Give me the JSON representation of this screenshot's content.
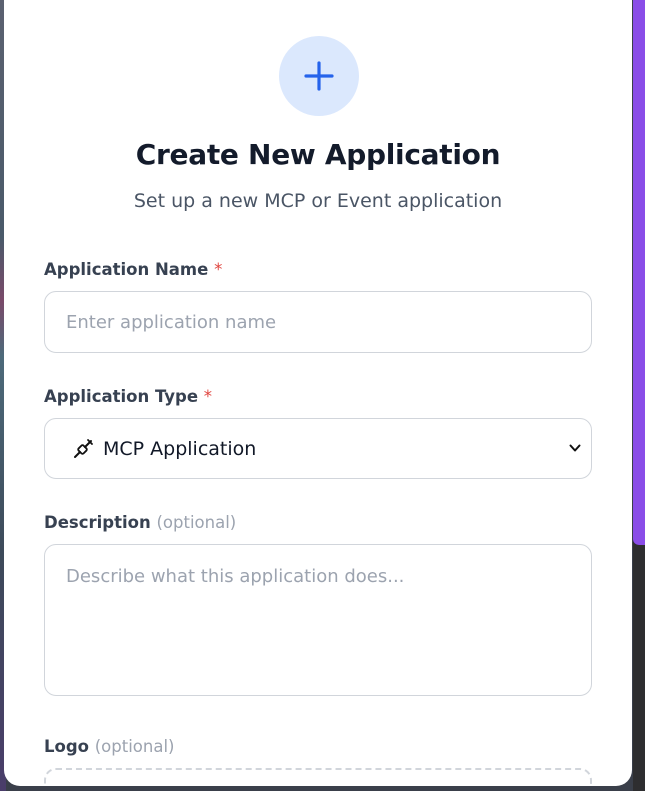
{
  "modal": {
    "title": "Create New Application",
    "subtitle": "Set up a new MCP or Event application",
    "header_icon": "plus-icon"
  },
  "form": {
    "name": {
      "label": "Application Name",
      "required_mark": "*",
      "placeholder": "Enter application name",
      "value": ""
    },
    "type": {
      "label": "Application Type",
      "required_mark": "*",
      "selected": "MCP Application",
      "icon": "plug-icon"
    },
    "description": {
      "label": "Description",
      "optional_text": "(optional)",
      "placeholder": "Describe what this application does...",
      "value": ""
    },
    "logo": {
      "label": "Logo",
      "optional_text": "(optional)"
    }
  },
  "colors": {
    "accent": "#2563eb",
    "icon_bg": "#dbe8fd",
    "required": "#e0443e",
    "scrollbar": "#8a4de8"
  }
}
